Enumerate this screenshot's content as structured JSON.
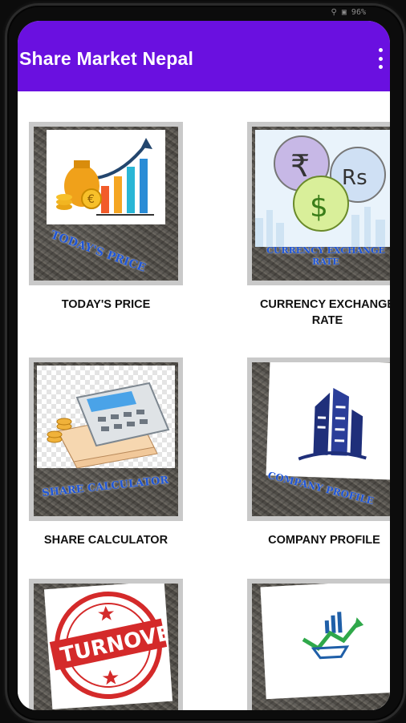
{
  "status": {
    "text": "⚲ ▣ 96%"
  },
  "app": {
    "title": "Share Market Nepal"
  },
  "cards": [
    {
      "label": "TODAY'S PRICE",
      "overlay": "TODAY'S PRICE",
      "icon": "money-growth-chart-icon"
    },
    {
      "label": "CURRENCY EXCHANGE RATE",
      "overlay": "CURRENCY EXCHANGE RATE",
      "icon": "currency-coins-icon",
      "symbols": [
        "₹",
        "Rs",
        "$"
      ]
    },
    {
      "label": "SHARE CALCULATOR",
      "overlay": "SHARE CALCULATOR",
      "icon": "calculator-icon"
    },
    {
      "label": "COMPANY PROFILE",
      "overlay": "COMPANY PROFILE",
      "icon": "building-icon"
    },
    {
      "label": "",
      "overlay": "",
      "icon": "turnover-stamp-icon",
      "stamp": "TURNOVER"
    },
    {
      "label": "",
      "overlay": "",
      "icon": "stock-trend-icon"
    }
  ],
  "colors": {
    "appbar": "#6a10e0",
    "overlay_text": "#1f56d8"
  }
}
